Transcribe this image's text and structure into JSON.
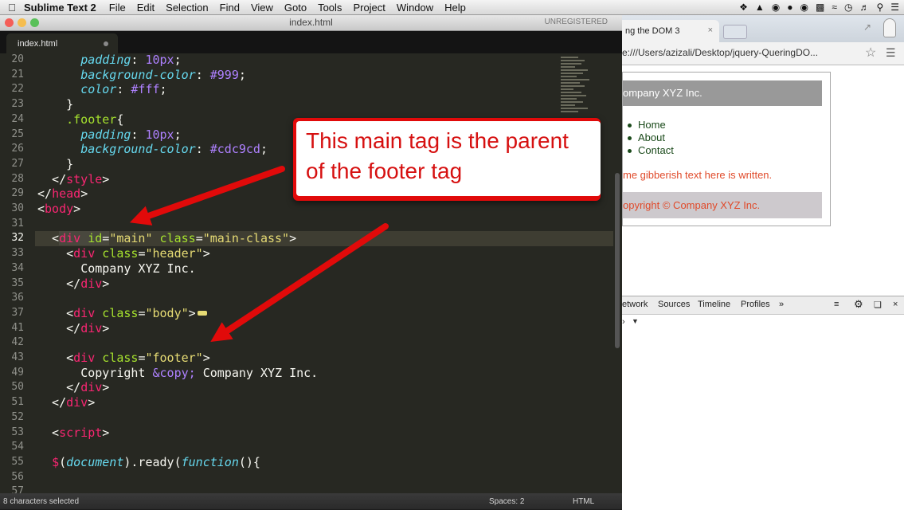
{
  "menubar": {
    "app_name": "Sublime Text 2",
    "items": [
      "File",
      "Edit",
      "Selection",
      "Find",
      "View",
      "Goto",
      "Tools",
      "Project",
      "Window",
      "Help"
    ]
  },
  "sublime": {
    "title": "index.html",
    "unregistered": "UNREGISTERED",
    "tab_label": "index.html",
    "line_numbers": [
      "20",
      "21",
      "22",
      "23",
      "24",
      "25",
      "26",
      "27",
      "28",
      "29",
      "30",
      "31",
      "32",
      "33",
      "34",
      "35",
      "36",
      "37",
      "41",
      "42",
      "43",
      "49",
      "50",
      "51",
      "52",
      "53",
      "54",
      "55",
      "56",
      "57",
      "58"
    ],
    "current_line": "32",
    "status_selection": "8 characters selected",
    "status_spaces": "Spaces: 2",
    "status_syntax": "HTML"
  },
  "code": {
    "l20a": "padding",
    "l20b": "10px",
    "l21a": "background-color",
    "l21b": "#999",
    "l22a": "color",
    "l22b": "#fff",
    "l23": "}",
    "l24": ".footer",
    "l25a": "padding",
    "l25b": "10px",
    "l26a": "background-color",
    "l26b": "#cdc9cd",
    "l27": "}",
    "l28": "style",
    "l29": "head",
    "l30": "body",
    "div": "div",
    "id": "id",
    "class": "class",
    "main_val": "\"main\"",
    "main_class_val": "\"main-class\"",
    "header_val": "\"header\"",
    "company": "Company XYZ Inc.",
    "body_val": "\"body\"",
    "footer_val": "\"footer\"",
    "copyright_text": "Copyright ",
    "copy_entity": "&copy;",
    "copyright_rest": " Company XYZ Inc.",
    "script": "script",
    "dollar": "$",
    "document": "document",
    "ready": ".ready(",
    "function": "function",
    "fn_end": "(){"
  },
  "callout": {
    "line1": "This main tag is the parent",
    "line2": "of the footer tag"
  },
  "browser": {
    "tab_title": "ng the DOM 3",
    "tab_close": "×",
    "url": "e:///Users/azizali/Desktop/jquery-QueringDO...",
    "page": {
      "header": "ompany XYZ Inc.",
      "nav": [
        "Home",
        "About",
        "Contact"
      ],
      "body_text": "me gibberish text here is written.",
      "footer": "opyright © Company XYZ Inc."
    },
    "devtools": {
      "tabs": [
        "etwork",
        "Sources",
        "Timeline",
        "Profiles"
      ],
      "more": "»",
      "console_arrow": "▼"
    }
  },
  "colors": {
    "callout_border": "#e10a0a",
    "callout_text": "#d61010",
    "arrow": "#e10a0a",
    "editor_bg": "#272822",
    "page_header_bg": "#999999",
    "page_footer_bg": "#cdc9cd"
  }
}
